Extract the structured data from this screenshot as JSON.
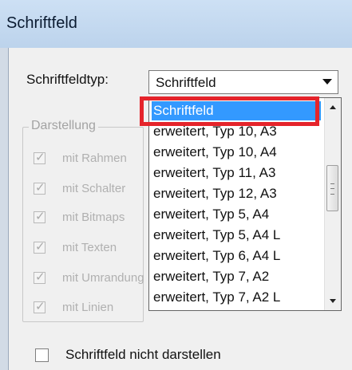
{
  "window": {
    "title": "Schriftfeld"
  },
  "form": {
    "type_label": "Schriftfeldtyp:",
    "combo_value": "Schriftfeld"
  },
  "group": {
    "legend": "Darstellung",
    "checkboxes": [
      {
        "label": "mit Rahmen",
        "checked": true,
        "enabled": false
      },
      {
        "label": "mit Schalter",
        "checked": true,
        "enabled": false
      },
      {
        "label": "mit Bitmaps",
        "checked": true,
        "enabled": false
      },
      {
        "label": "mit Texten",
        "checked": true,
        "enabled": false
      },
      {
        "label": "mit Umrandung",
        "checked": true,
        "enabled": false
      },
      {
        "label": "mit Linien",
        "checked": true,
        "enabled": false
      }
    ]
  },
  "dropdown": {
    "items": [
      {
        "label": "Schriftfeld",
        "selected": true
      },
      {
        "label": "erweitert, Typ 10, A3",
        "selected": false
      },
      {
        "label": "erweitert, Typ 10, A4",
        "selected": false
      },
      {
        "label": "erweitert, Typ 11, A3",
        "selected": false
      },
      {
        "label": "erweitert, Typ 12, A3",
        "selected": false
      },
      {
        "label": "erweitert, Typ 5, A4",
        "selected": false
      },
      {
        "label": "erweitert, Typ 5, A4 L",
        "selected": false
      },
      {
        "label": "erweitert, Typ 6, A4 L",
        "selected": false
      },
      {
        "label": "erweitert, Typ 7, A2",
        "selected": false
      },
      {
        "label": "erweitert, Typ 7, A2 L",
        "selected": false
      }
    ]
  },
  "bottom": {
    "checkbox_label": "Schriftfeld nicht darstellen",
    "checked": false
  },
  "colors": {
    "selection": "#3399ff",
    "highlight_frame": "#e5242b",
    "disabled_text": "#b0b0b0"
  }
}
